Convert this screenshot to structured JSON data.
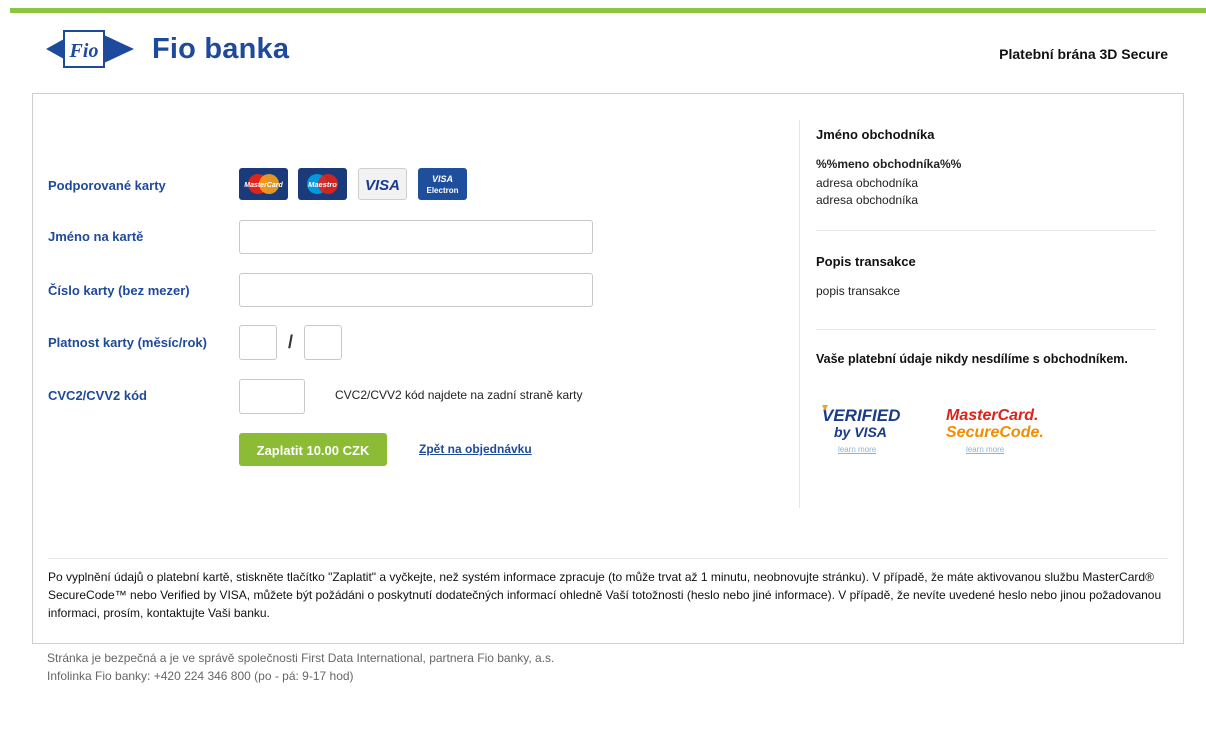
{
  "header": {
    "bank_name": "Fio banka",
    "logo_flag_text": "Fio",
    "gateway_title": "Platební brána 3D Secure"
  },
  "form": {
    "supported_cards_label": "Podporované karty",
    "cards": [
      {
        "name": "MasterCard",
        "icon": "mastercard-logo"
      },
      {
        "name": "Maestro",
        "icon": "maestro-logo"
      },
      {
        "name": "VISA",
        "icon": "visa-logo"
      },
      {
        "name": "VISA Electron",
        "icon": "visa-electron-logo"
      }
    ],
    "name_label": "Jméno na kartě",
    "name_value": "",
    "number_label": "Číslo karty (bez mezer)",
    "number_value": "",
    "expiry_label": "Platnost karty (měsíc/rok)",
    "expiry_separator": "/",
    "expiry_month": "",
    "expiry_year": "",
    "cvc_label": "CVC2/CVV2 kód",
    "cvc_value": "",
    "cvc_hint": "CVC2/CVV2 kód najdete na zadní straně karty",
    "pay_button": "Zaplatit 10.00 CZK",
    "back_link": "Zpět na objednávku"
  },
  "merchant": {
    "heading": "Jméno obchodníka",
    "name": "%%meno obchodníka%%",
    "address_1": "adresa obchodníka",
    "address_2": "adresa obchodníka"
  },
  "transaction": {
    "heading": "Popis transakce",
    "description": "popis transakce"
  },
  "privacy_note": "Vaše platební údaje nikdy nesdílíme s obchodníkem.",
  "security_brands": {
    "visa_line1": "VERIFIED",
    "visa_line2": "by VISA",
    "visa_learn": "learn more",
    "mc_line1": "MasterCard.",
    "mc_line2": "SecureCode.",
    "mc_learn": "learn more"
  },
  "notice": "Po vyplnění údajů o platební kartě, stiskněte tlačítko \"Zaplatit\" a vyčkejte, než systém informace zpracuje (to může trvat až 1 minutu, neobnovujte stránku). V případě, že máte aktivovanou službu MasterCard® SecureCode™ nebo Verified by VISA, můžete být požádáni o poskytnutí dodatečných informací ohledně Vaší totožnosti (heslo nebo jiné informace). V případě, že nevíte uvedené heslo nebo jinou požadovanou informaci, prosím, kontaktujte Vaši banku.",
  "footer": {
    "line1": "Stránka je bezpečná a je ve správě společnosti First Data International, partnera Fio banky, a.s.",
    "line2": "Infolinka Fio banky: +420 224 346 800 (po - pá: 9-17 hod)"
  },
  "colors": {
    "accent_green": "#8cc63f",
    "brand_blue": "#1e4a9b",
    "button_green": "#8cbc36"
  }
}
